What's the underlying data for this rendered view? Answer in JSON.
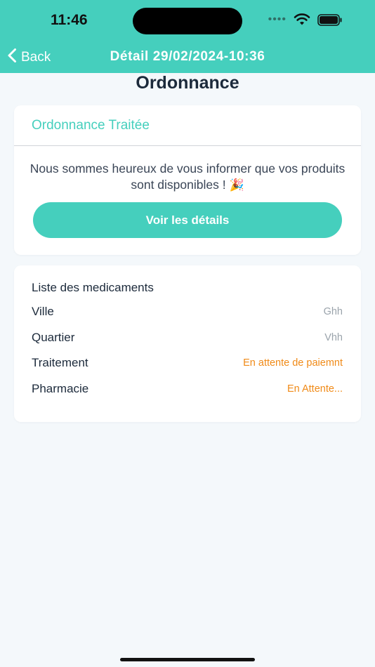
{
  "status_bar": {
    "time": "11:46",
    "dots": "••••"
  },
  "nav": {
    "back_label": "Back",
    "title": "Détail 29/02/2024-10:36"
  },
  "page": {
    "title": "Ordonnance"
  },
  "status_card": {
    "title": "Ordonnance Traitée",
    "message": "Nous sommes heureux de vous informer que vos produits sont disponibles !",
    "emoji": "🎉",
    "button_label": "Voir les détails"
  },
  "meds_card": {
    "title": "Liste des medicaments",
    "rows": [
      {
        "label": "Ville",
        "value": "Ghh"
      },
      {
        "label": "Quartier",
        "value": "Vhh"
      },
      {
        "label": "Traitement",
        "value": "En attente de paiemnt"
      },
      {
        "label": "Pharmacie",
        "value": "En Attente..."
      }
    ]
  },
  "colors": {
    "accent": "#45cfbd",
    "pending": "#f08a17",
    "muted": "#9aa3ab",
    "text": "#1c2a3b"
  }
}
